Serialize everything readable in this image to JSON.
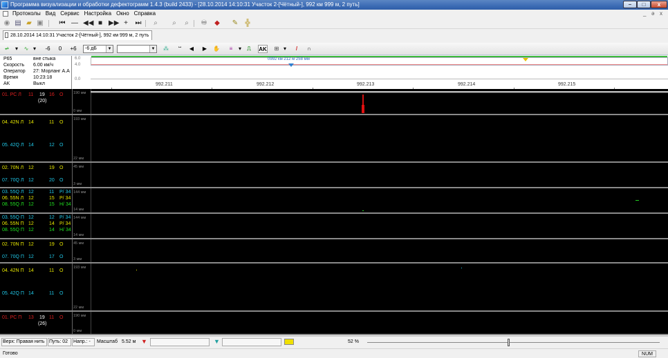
{
  "window": {
    "title": "Программа визуализации и обработки дефектограмм 1.4.3 (build 2433) - [28.10.2014 14:10:31 Участок 2-[Чётный-], 992 км 999 м, 2 путь]",
    "min_label": "–",
    "max_label": "□",
    "close_label": "x"
  },
  "menu": {
    "items": [
      "Протоколы",
      "Вид",
      "Сервис",
      "Настройка",
      "Окно",
      "Справка"
    ],
    "mdi_controls": [
      "_",
      "ə",
      "x"
    ]
  },
  "tab": {
    "label": "28.10.2014 14:10:31 Участок 2-[Чётный-], 992 км 999 м, 2 путь"
  },
  "toolbar2": {
    "minus6": "-6",
    "zero": "0",
    "plus6": "+6",
    "gain_value": "-6 дБ",
    "mode_value": "",
    "ak_label": "AK"
  },
  "info": {
    "rows": [
      {
        "label": "P65",
        "value": "вне стыка"
      },
      {
        "label": "Скорость",
        "value": "6.00 км/ч"
      },
      {
        "label": "Оператор",
        "value": "27: Морланг А.А"
      },
      {
        "label": "Время",
        "value": "10:23:18"
      },
      {
        "label": "AK",
        "value": "Выкл"
      }
    ]
  },
  "ruler": {
    "axis_top": "6.0",
    "axis_mid": "4.0",
    "axis_low": "0.0",
    "coord_label": "0992 км 212 м 258 мм",
    "km_labels": [
      "992.211",
      "992.212",
      "992.213",
      "992.214",
      "992.215"
    ]
  },
  "lanes": [
    {
      "scope_top": "190 мм",
      "scope_bottom": "0 мм",
      "channels": [
        {
          "name": "01. РС Л",
          "a": "11",
          "b": "19",
          "c": "16",
          "d": "О",
          "color": "#e02020",
          "extra": "(20)"
        }
      ]
    },
    {
      "scope_top": "193 мм",
      "scope_bottom": "22 мм",
      "channels": [
        {
          "name": "04. 42N Л",
          "a": "14",
          "b": "",
          "c": "11",
          "d": "О",
          "color": "#e8e800"
        },
        {
          "name": "05. 42Q Л",
          "a": "14",
          "b": "",
          "c": "12",
          "d": "О",
          "color": "#20c8e8"
        }
      ]
    },
    {
      "scope_top": "45 мм",
      "scope_bottom": "3 мм",
      "channels": [
        {
          "name": "02. 70N Л",
          "a": "12",
          "b": "",
          "c": "19",
          "d": "О",
          "color": "#e8e800"
        },
        {
          "name": "07. 70Q Л",
          "a": "12",
          "b": "",
          "c": "20",
          "d": "О",
          "color": "#20c8e8"
        }
      ]
    },
    {
      "scope_top": "144 мм",
      "scope_bottom": "14 мм",
      "channels": [
        {
          "name": "03. 55Q Л",
          "a": "12",
          "b": "",
          "c": "11",
          "d": "Р/ 34",
          "color": "#20c8e8"
        },
        {
          "name": "06. 55N Л",
          "a": "12",
          "b": "",
          "c": "15",
          "d": "Р/ 34",
          "color": "#e8e800"
        },
        {
          "name": "08. 55Q Л",
          "a": "12",
          "b": "",
          "c": "15",
          "d": "Н/ 34",
          "color": "#20e020"
        }
      ]
    },
    {
      "scope_top": "144 мм",
      "scope_bottom": "14 мм",
      "channels": [
        {
          "name": "03. 55Q П",
          "a": "12",
          "b": "",
          "c": "12",
          "d": "Р/ 34",
          "color": "#20c8e8"
        },
        {
          "name": "06. 55N П",
          "a": "12",
          "b": "",
          "c": "14",
          "d": "Р/ 34",
          "color": "#e8e800"
        },
        {
          "name": "08. 55Q П",
          "a": "12",
          "b": "",
          "c": "14",
          "d": "Н/ 34",
          "color": "#20e020"
        }
      ]
    },
    {
      "scope_top": "45 мм",
      "scope_bottom": "3 мм",
      "channels": [
        {
          "name": "02. 70N П",
          "a": "12",
          "b": "",
          "c": "19",
          "d": "О",
          "color": "#e8e800"
        },
        {
          "name": "07. 70Q П",
          "a": "12",
          "b": "",
          "c": "17",
          "d": "О",
          "color": "#20c8e8"
        }
      ]
    },
    {
      "scope_top": "193 мм",
      "scope_bottom": "22 мм",
      "channels": [
        {
          "name": "04. 42N П",
          "a": "14",
          "b": "",
          "c": "11",
          "d": "О",
          "color": "#e8e800"
        },
        {
          "name": "05. 42Q П",
          "a": "14",
          "b": "",
          "c": "11",
          "d": "О",
          "color": "#20c8e8"
        }
      ]
    },
    {
      "scope_top": "190 мм",
      "scope_bottom": "0 мм",
      "channels": [
        {
          "name": "01. РС П",
          "a": "13",
          "b": "19",
          "c": "11",
          "d": "О",
          "color": "#e02020",
          "extra": "(26)"
        }
      ]
    }
  ],
  "bottom": {
    "side": "Верх: Правая нить",
    "track": "Путь: 02",
    "direction": "Напр.: -",
    "scale_label": "Масштаб",
    "scale_value": "5.52 м",
    "zoom": "52 %",
    "zoom_fraction": 0.48
  },
  "status": {
    "ready": "Готово",
    "num": "NUM"
  },
  "colors": {
    "accent": "#3d6cb5",
    "plot_bg": "#000000"
  }
}
